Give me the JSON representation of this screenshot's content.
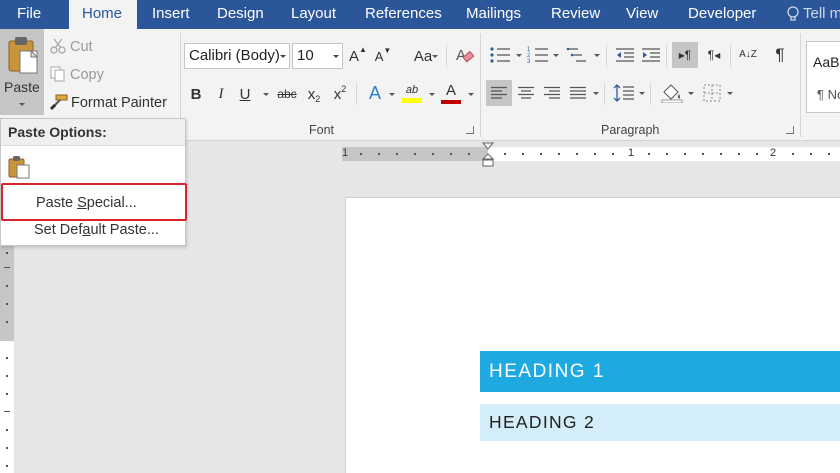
{
  "tabs": [
    {
      "label": "File",
      "active": false
    },
    {
      "label": "Home",
      "active": true
    },
    {
      "label": "Insert",
      "active": false
    },
    {
      "label": "Design",
      "active": false
    },
    {
      "label": "Layout",
      "active": false
    },
    {
      "label": "References",
      "active": false
    },
    {
      "label": "Mailings",
      "active": false
    },
    {
      "label": "Review",
      "active": false
    },
    {
      "label": "View",
      "active": false
    },
    {
      "label": "Developer",
      "active": false
    }
  ],
  "tell_me": "Tell m",
  "clipboard": {
    "paste_label": "Paste",
    "cut_label": "Cut",
    "copy_label": "Copy",
    "format_painter_label": "Format Painter"
  },
  "font": {
    "group_label": "Font",
    "font_name": "Calibri (Body)",
    "font_size": "10",
    "grow_glyph": "A",
    "shrink_glyph": "A",
    "change_case_glyph": "Aa",
    "bold_glyph": "B",
    "italic_glyph": "I",
    "underline_glyph": "U",
    "strike_glyph": "abc",
    "subscript_glyph": "x",
    "subscript_sub": "2",
    "superscript_glyph": "x",
    "superscript_sup": "2",
    "effects_glyph": "A",
    "highlight_glyph": "ab",
    "font_color_glyph": "A",
    "highlight_color": "#ffff00",
    "font_color_bar": "#c00000"
  },
  "paragraph": {
    "group_label": "Paragraph",
    "pilcrow": "¶",
    "ltr_glyph": "▸¶",
    "rtl_glyph": "¶◂",
    "sort_glyph": "A↓Z"
  },
  "styles": {
    "sample": "AaBbCcDc",
    "name": "¶ Normal"
  },
  "paste_menu": {
    "header": "Paste Options:",
    "paste_special_pre": "Paste ",
    "paste_special_u": "S",
    "paste_special_post": "pecial...",
    "set_default_pre": "Set Def",
    "set_default_u": "a",
    "set_default_post": "ult Paste..."
  },
  "ruler": {
    "numbers": [
      "1",
      "1",
      "2"
    ]
  },
  "document": {
    "heading_1": "HEADING 1",
    "heading_2": "HEADING 2"
  },
  "colors": {
    "brand_blue": "#2b579a",
    "heading1_fill": "#1ea9e0",
    "heading2_fill": "#d4eef9",
    "highlight_box": "#d9232e"
  }
}
